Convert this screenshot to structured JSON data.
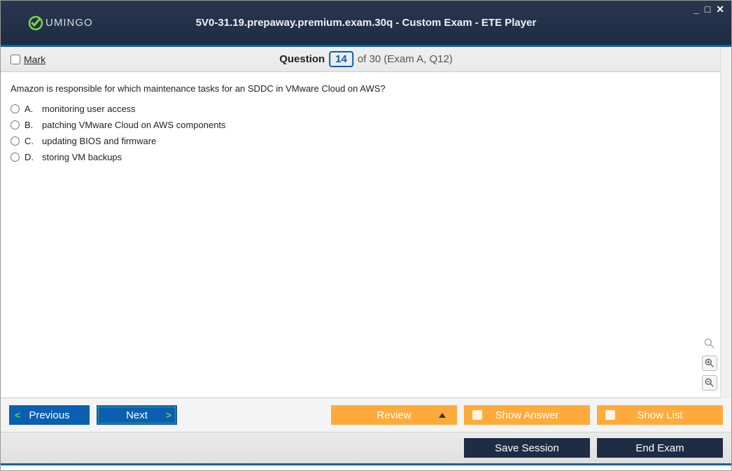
{
  "window": {
    "title": "5V0-31.19.prepaway.premium.exam.30q - Custom Exam - ETE Player",
    "logo_text": "UMINGO"
  },
  "questionbar": {
    "mark_label": "Mark",
    "question_word": "Question",
    "current_num": "14",
    "of_text": "of 30 (Exam A, Q12)"
  },
  "question": {
    "text": "Amazon is responsible for which maintenance tasks for an SDDC in VMware Cloud on AWS?",
    "options": [
      {
        "letter": "A.",
        "text": "monitoring user access"
      },
      {
        "letter": "B.",
        "text": "patching VMware Cloud on AWS components"
      },
      {
        "letter": "C.",
        "text": "updating BIOS and firmware"
      },
      {
        "letter": "D.",
        "text": "storing VM backups"
      }
    ]
  },
  "footer": {
    "previous": "Previous",
    "next": "Next",
    "review": "Review",
    "show_answer": "Show Answer",
    "show_list": "Show List",
    "save_session": "Save Session",
    "end_exam": "End Exam"
  }
}
